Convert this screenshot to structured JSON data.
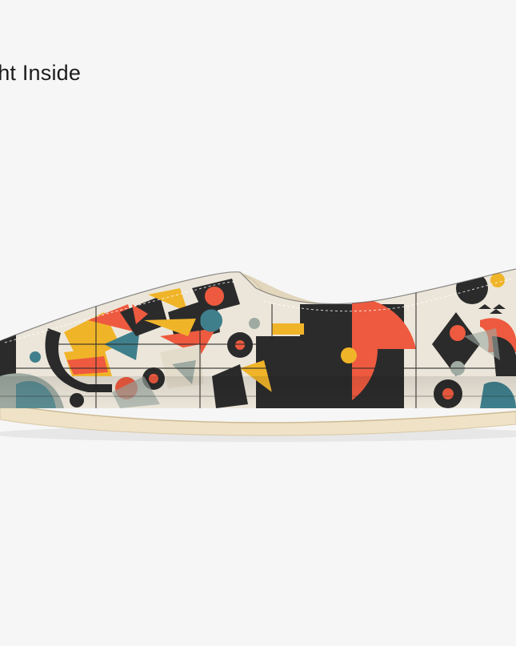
{
  "caption": {
    "text": "ght Inside"
  },
  "product": {
    "image_subject": "canvas-slip-on-shoe-side-view",
    "palette": {
      "background": "#f6f6f6",
      "canvas": "#ece6da",
      "black": "#2b2b2b",
      "red": "#ee5a3f",
      "mustard": "#f0b429",
      "teal": "#3f7f8c",
      "sage": "#9eaaa2",
      "sole": "#efe2c6"
    }
  }
}
